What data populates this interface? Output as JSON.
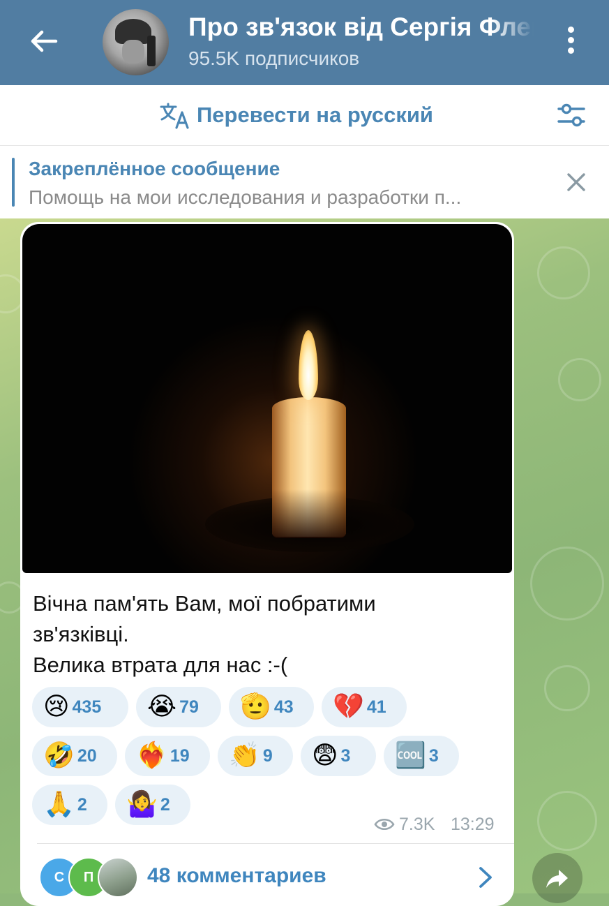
{
  "header": {
    "title": "Про зв'язок від Сергія Флеша",
    "subtitle": "95.5K подписчиков",
    "back_icon": "arrow-left-icon",
    "menu_icon": "more-vertical-icon",
    "colors": {
      "background": "#517da2",
      "text": "#ffffff"
    }
  },
  "translate_bar": {
    "label": "Перевести на русский",
    "icon": "translate-icon",
    "settings_icon": "sliders-icon"
  },
  "pinned": {
    "title": "Закреплённое сообщение",
    "text": "Помощь на мои исследования и разработки п...",
    "close_icon": "close-icon"
  },
  "message": {
    "image_alt": "candle-photo",
    "text": "Вічна пам'ять Вам, мої побратими\nзв'язківці.\nВелика втрата для нас :-(",
    "reactions": [
      {
        "emoji": "😢",
        "count": "435"
      },
      {
        "emoji": "😭",
        "count": "79"
      },
      {
        "emoji": "🫡",
        "count": "43"
      },
      {
        "emoji": "💔",
        "count": "41"
      },
      {
        "emoji": "🤣",
        "count": "20"
      },
      {
        "emoji": "❤️‍🔥",
        "count": "19"
      },
      {
        "emoji": "👏",
        "count": "9"
      },
      {
        "emoji": "😨",
        "count": "3"
      },
      {
        "emoji": "🆒",
        "count": "3"
      },
      {
        "emoji": "🙏",
        "count": "2"
      },
      {
        "emoji": "🤷‍♀️",
        "count": "2"
      }
    ],
    "views": "7.3K",
    "time": "13:29",
    "commenters": [
      {
        "initial": "С",
        "color": "#4aa8e8"
      },
      {
        "initial": "П",
        "color": "#5dbb4c"
      }
    ],
    "comments_label": "48 комментариев"
  },
  "colors": {
    "accent": "#4a86b4",
    "reaction_bg": "#e8f1f8",
    "reaction_text": "#3f86be"
  }
}
